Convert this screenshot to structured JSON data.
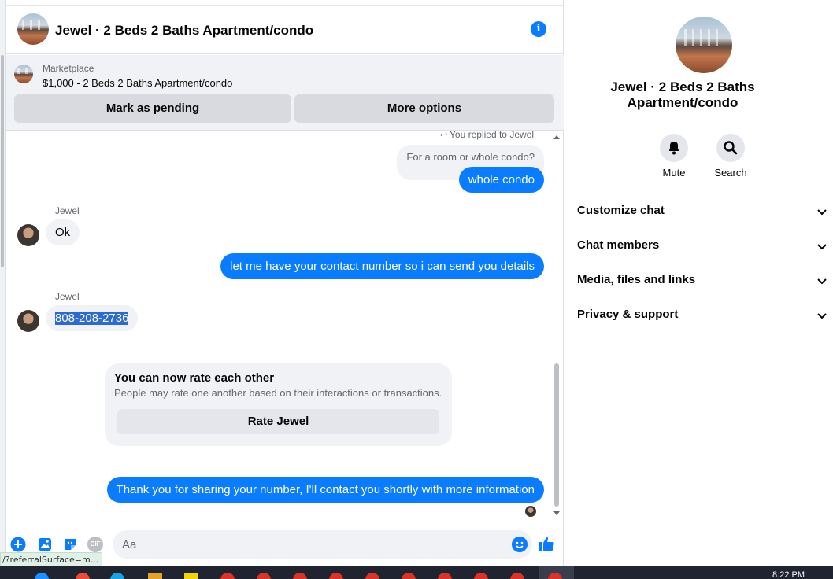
{
  "header": {
    "title": "Jewel · 2 Beds 2 Baths Apartment/condo",
    "info_icon": "info-icon"
  },
  "marketplace": {
    "label": "Marketplace",
    "listing": "$1,000 - 2 Beds 2 Baths Apartment/condo",
    "mark_pending_label": "Mark as pending",
    "more_options_label": "More options"
  },
  "messages": {
    "replied_note": "You replied to Jewel",
    "quoted_text": "For a room or whole condo?",
    "msg1": "whole condo",
    "sender1": "Jewel",
    "msg2": "Ok",
    "msg3": "let me have your contact number so i can send you details",
    "sender2": "Jewel",
    "msg4": "808-208-2736",
    "msg5": "Thank you for sharing your number, I'll contact you shortly with more information"
  },
  "rating": {
    "title": "You can now rate each other",
    "subtitle": "People may rate one another based on their interactions or transactions.",
    "button_label": "Rate Jewel"
  },
  "composer": {
    "placeholder": "Aa",
    "icons": [
      "plus-circle-icon",
      "photo-icon",
      "sticker-icon",
      "gif-icon",
      "emoji-icon",
      "thumbs-up-icon"
    ],
    "gif_text": "GIF"
  },
  "status_url": "/?referralSurface=m...",
  "sidebar": {
    "name": "Jewel · 2 Beds 2 Baths Apartment/condo",
    "actions": [
      {
        "label": "Mute",
        "icon": "bell-icon"
      },
      {
        "label": "Search",
        "icon": "search-icon"
      }
    ],
    "sections": [
      {
        "label": "Customize chat"
      },
      {
        "label": "Chat members"
      },
      {
        "label": "Media, files and links"
      },
      {
        "label": "Privacy & support"
      }
    ]
  },
  "taskbar": {
    "time": "8:22 PM"
  },
  "colors": {
    "accent": "#0a7cff",
    "bubble_in": "#f0f2f5",
    "button_gray": "#d8dadf"
  }
}
